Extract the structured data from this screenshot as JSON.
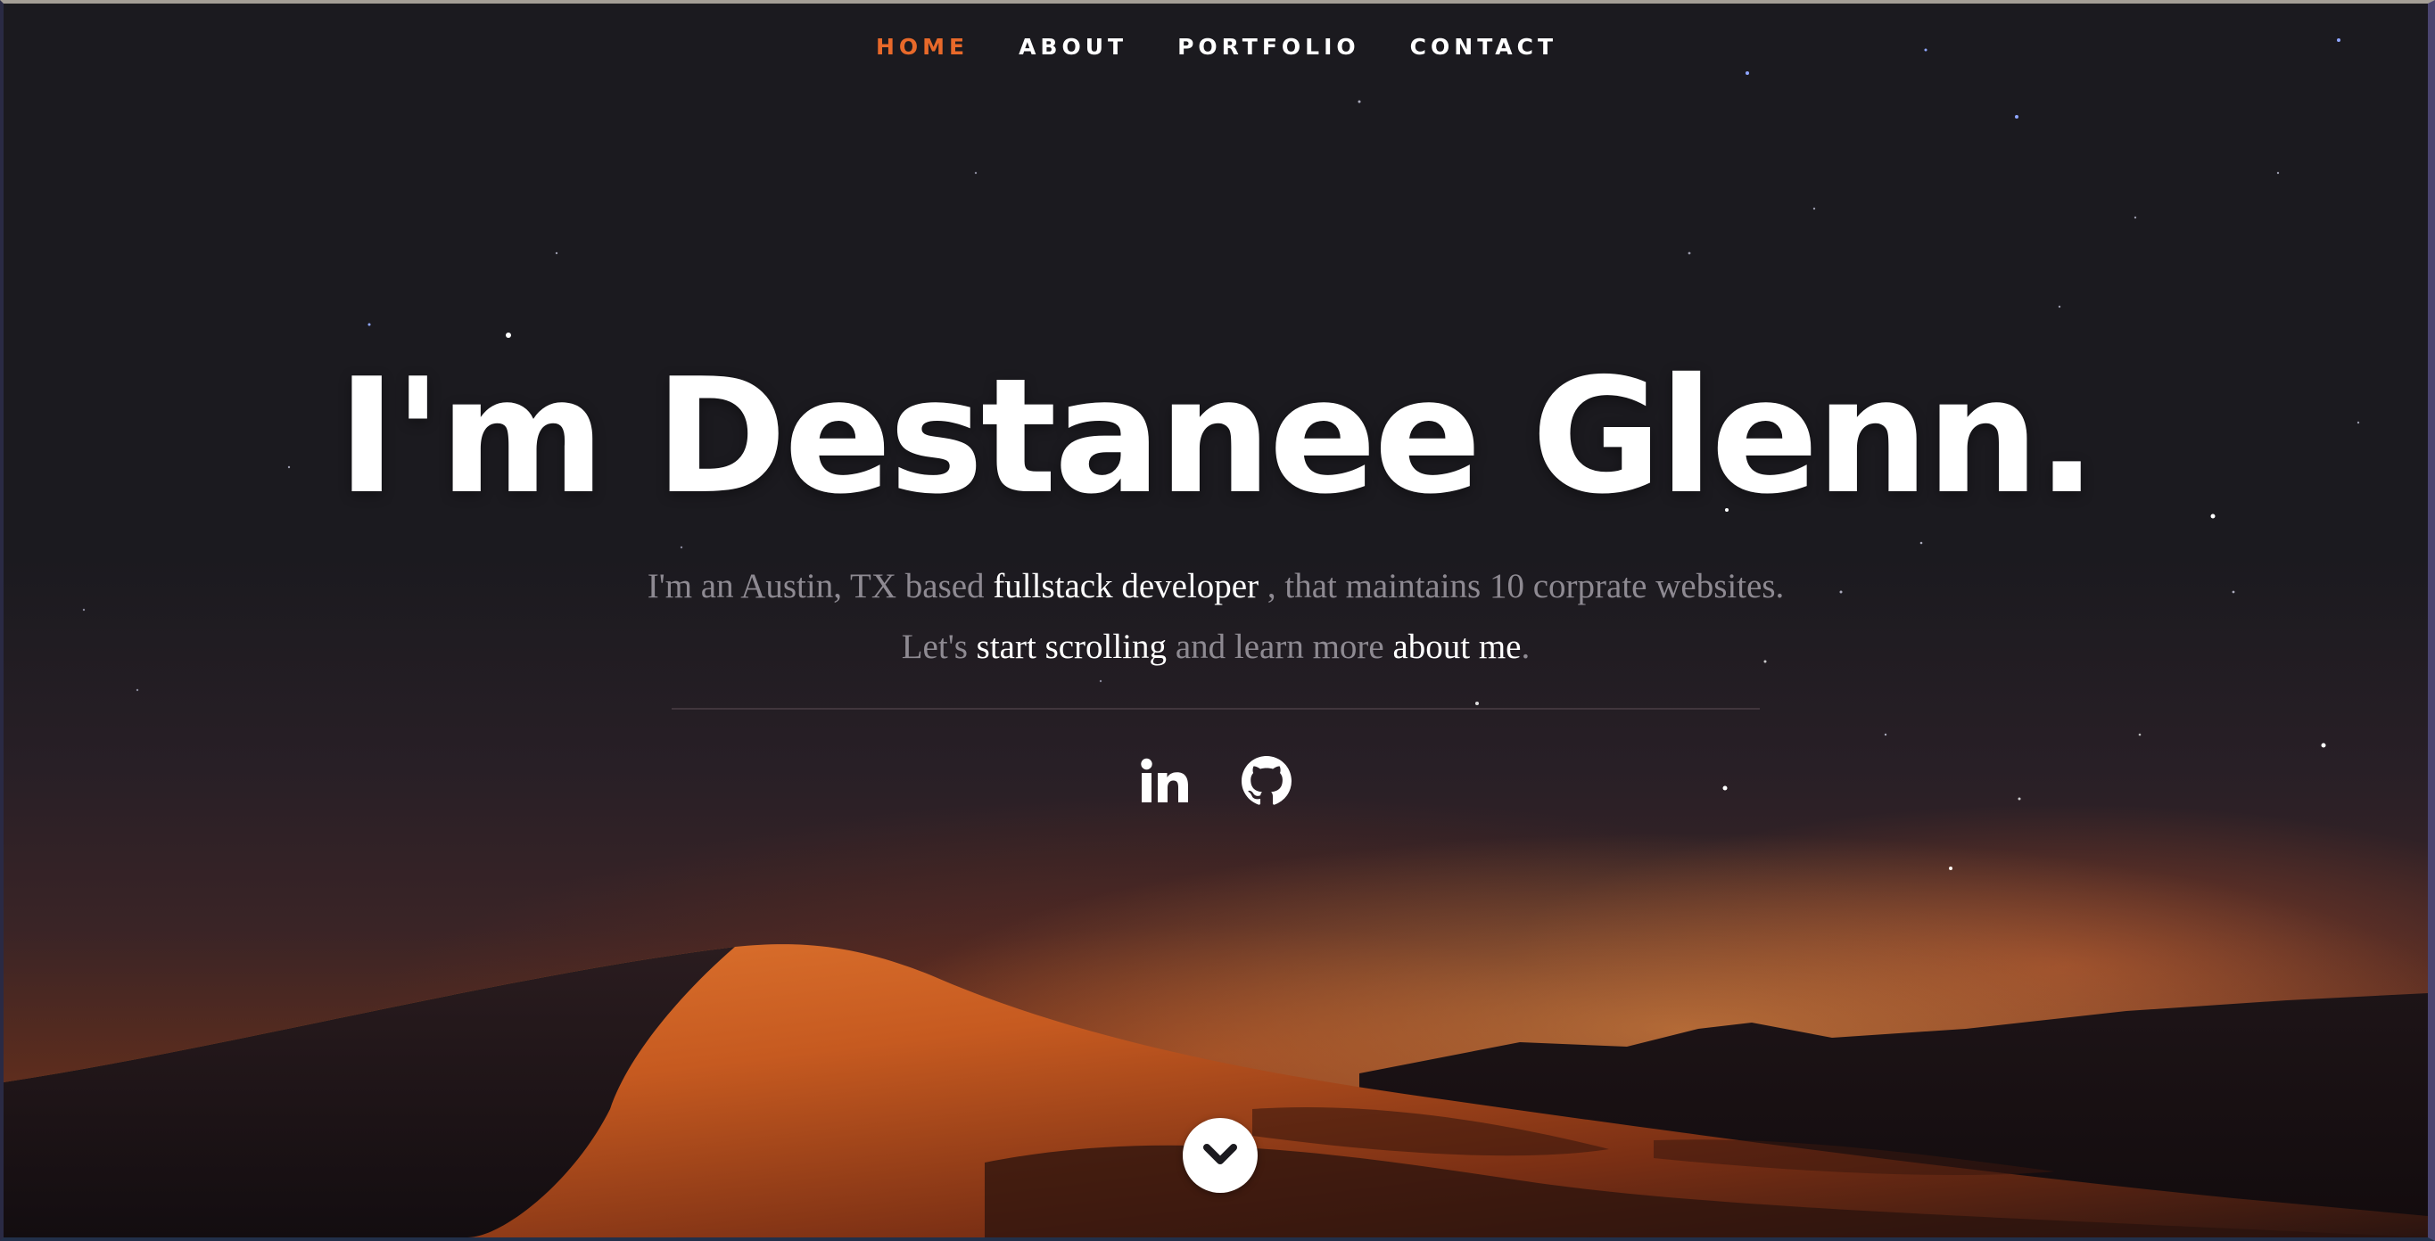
{
  "nav": {
    "items": [
      {
        "label": "HOME",
        "active": true
      },
      {
        "label": "ABOUT",
        "active": false
      },
      {
        "label": "PORTFOLIO",
        "active": false
      },
      {
        "label": "CONTACT",
        "active": false
      }
    ]
  },
  "hero": {
    "title": "I'm Destanee Glenn.",
    "desc": {
      "part1": "I'm an Austin, TX based ",
      "link1": "fullstack developer",
      "part2": " , that maintains 10 corprate websites. Let's ",
      "link2": "start scrolling",
      "part3": " and learn more ",
      "link3": "about me",
      "part4": "."
    }
  },
  "social": {
    "linkedin_icon": "linkedin-icon",
    "github_icon": "github-icon"
  },
  "scroll_icon": "chevron-down-icon",
  "colors": {
    "accent": "#e8692a",
    "sky": "#1b1a1f",
    "dune": "#c4581f",
    "text_muted": "#8e8a92",
    "text_white": "#ffffff"
  }
}
